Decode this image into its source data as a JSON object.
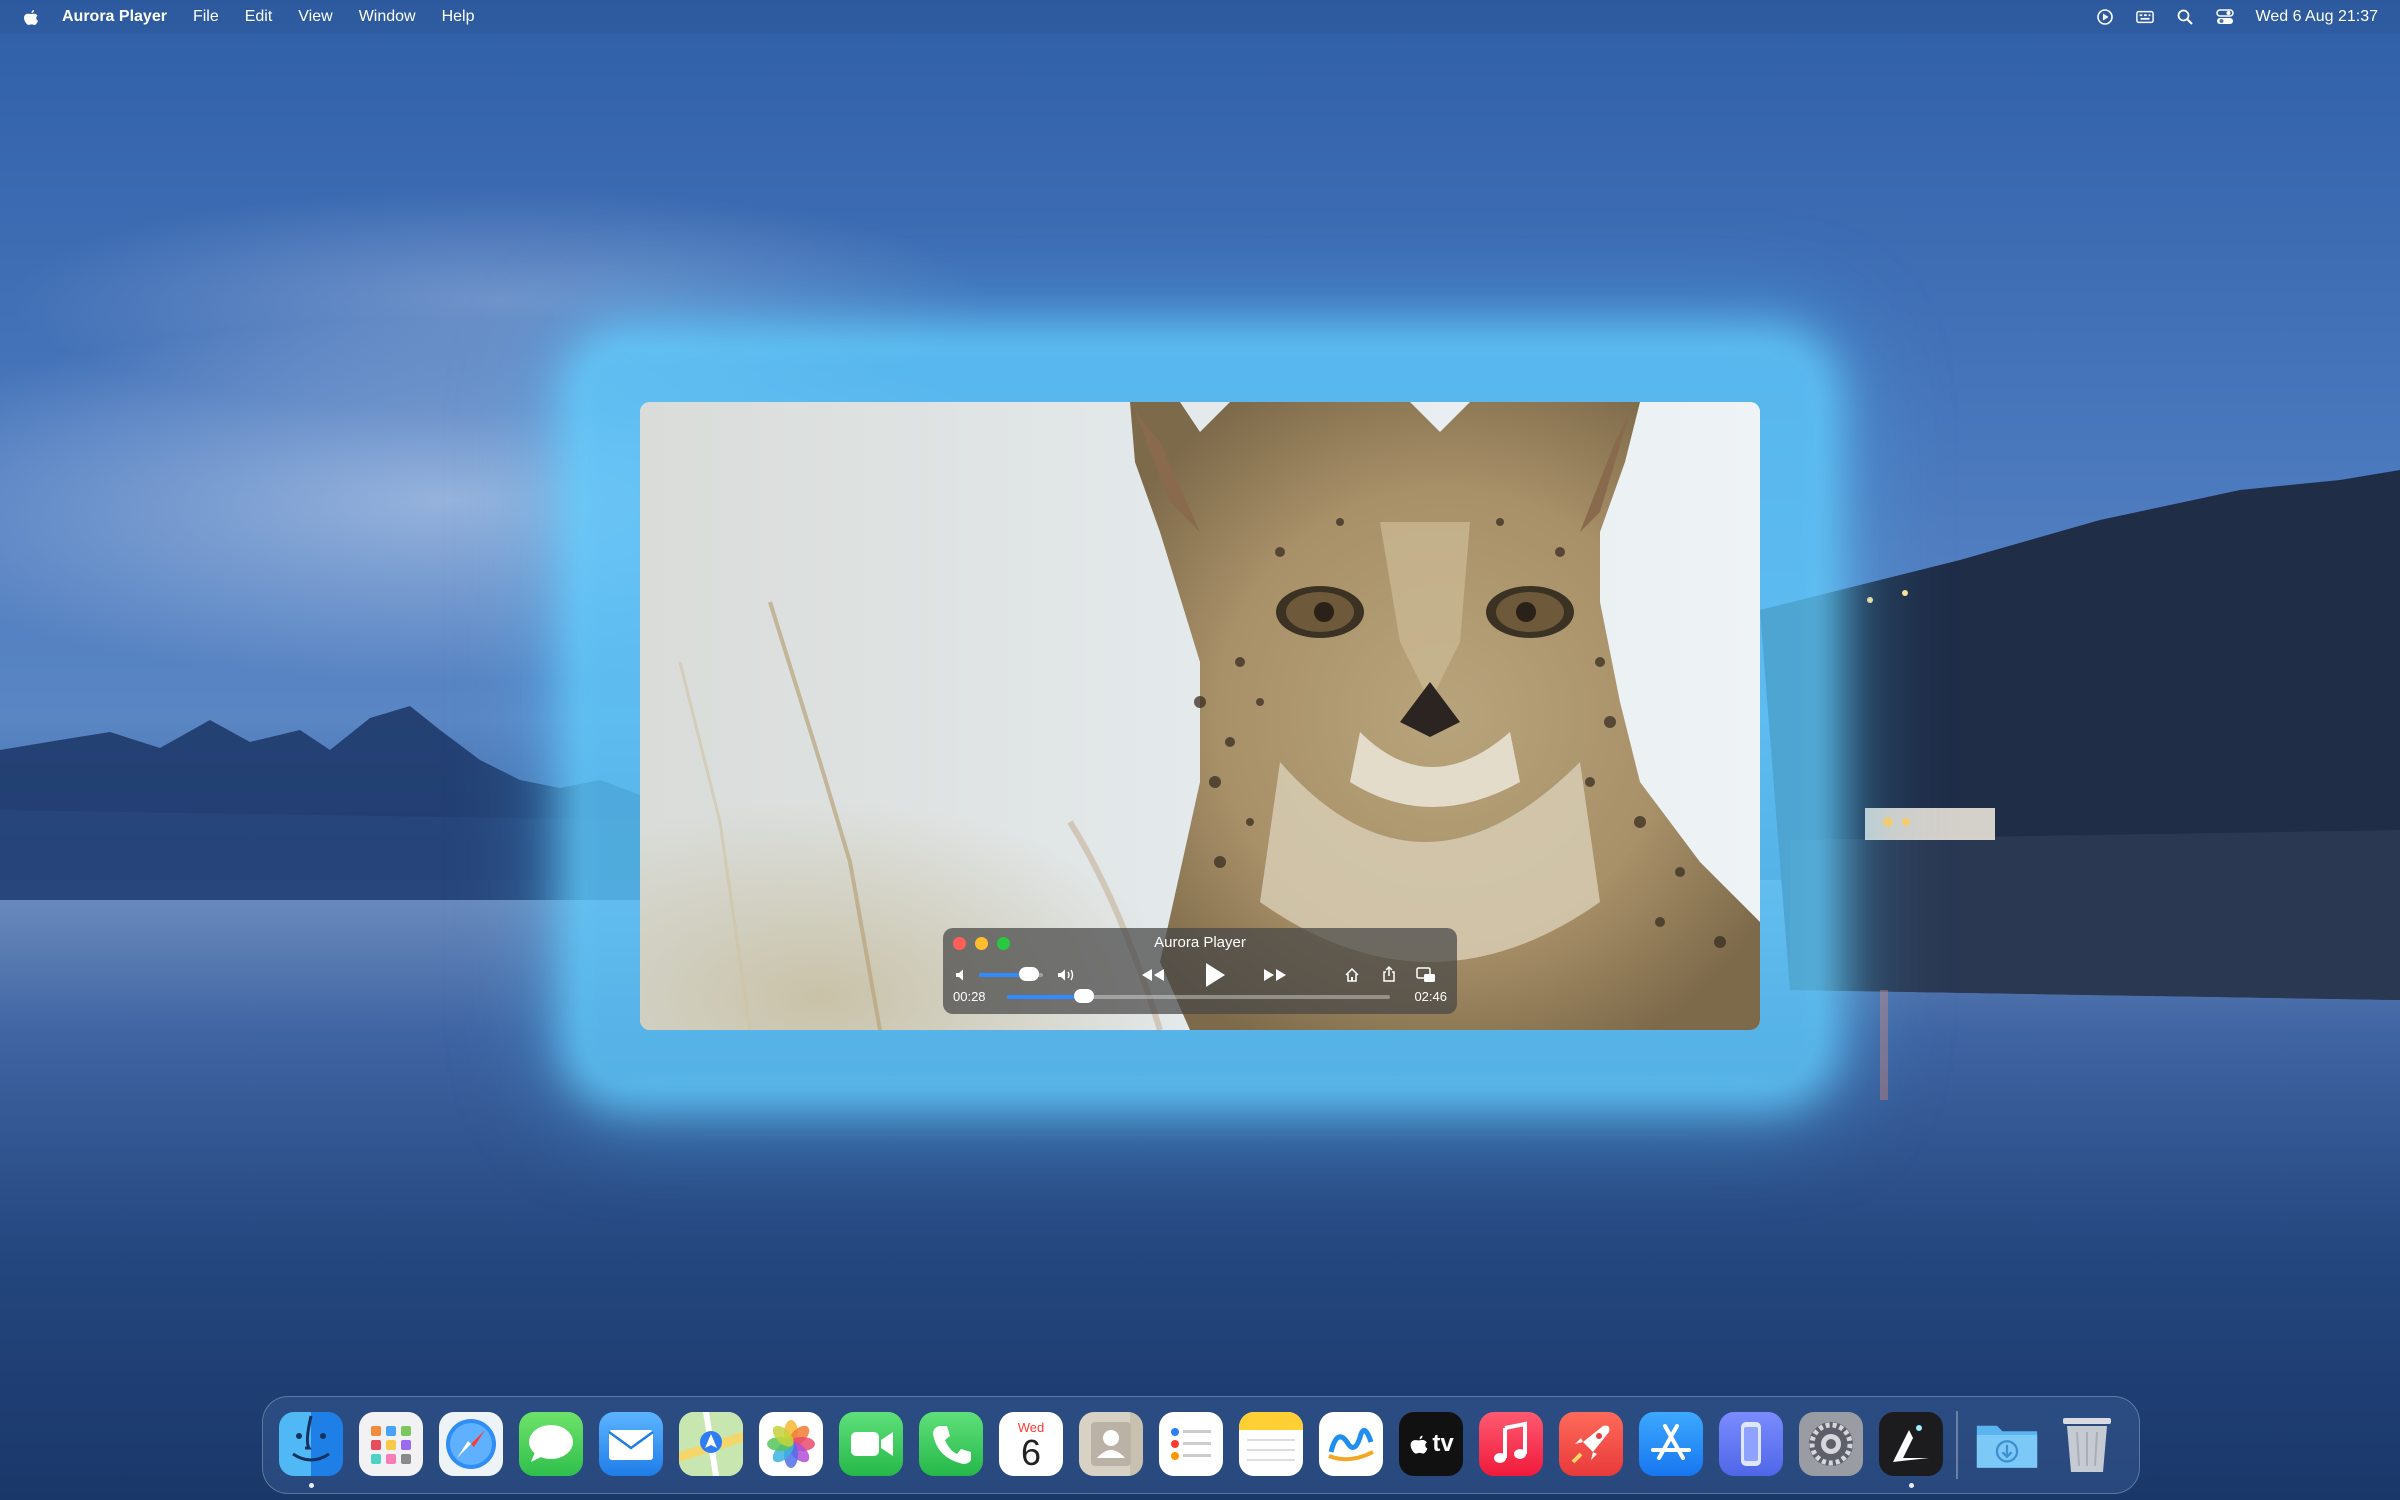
{
  "menubar": {
    "app_name": "Aurora Player",
    "menus": [
      "File",
      "Edit",
      "View",
      "Window",
      "Help"
    ],
    "clock": "Wed 6 Aug 21:37",
    "status_icons": [
      "play-circle-icon",
      "keyboard-icon",
      "search-icon",
      "control-center-icon"
    ]
  },
  "player": {
    "title": "Aurora Player",
    "current_time": "00:28",
    "duration": "02:46",
    "progress": 0.2,
    "volume": 0.78
  },
  "dock": {
    "apps": [
      {
        "name": "Finder",
        "icon": "finder-icon",
        "running": true
      },
      {
        "name": "Launchpad",
        "icon": "launchpad-icon"
      },
      {
        "name": "Safari",
        "icon": "safari-icon"
      },
      {
        "name": "Messages",
        "icon": "messages-icon"
      },
      {
        "name": "Mail",
        "icon": "mail-icon"
      },
      {
        "name": "Maps",
        "icon": "maps-icon"
      },
      {
        "name": "Photos",
        "icon": "photos-icon"
      },
      {
        "name": "FaceTime",
        "icon": "facetime-icon"
      },
      {
        "name": "Phone",
        "icon": "phone-icon"
      },
      {
        "name": "Calendar",
        "icon": "calendar-icon",
        "day_label": "Wed",
        "day_number": "6"
      },
      {
        "name": "Contacts",
        "icon": "contacts-icon"
      },
      {
        "name": "Reminders",
        "icon": "reminders-icon"
      },
      {
        "name": "Notes",
        "icon": "notes-icon"
      },
      {
        "name": "Freeform",
        "icon": "freeform-icon"
      },
      {
        "name": "TV",
        "icon": "tv-icon",
        "label": "tv"
      },
      {
        "name": "Music",
        "icon": "music-icon"
      },
      {
        "name": "Rocket Typist",
        "icon": "rocket-icon"
      },
      {
        "name": "App Store",
        "icon": "app-store-icon"
      },
      {
        "name": "iPhone Mirroring",
        "icon": "iphone-mirroring-icon"
      },
      {
        "name": "System Settings",
        "icon": "system-settings-icon"
      },
      {
        "name": "Aurora Player",
        "icon": "aurora-player-icon",
        "running": true
      }
    ],
    "extras": [
      {
        "name": "Downloads",
        "icon": "downloads-folder-icon"
      },
      {
        "name": "Trash",
        "icon": "trash-icon"
      }
    ]
  }
}
